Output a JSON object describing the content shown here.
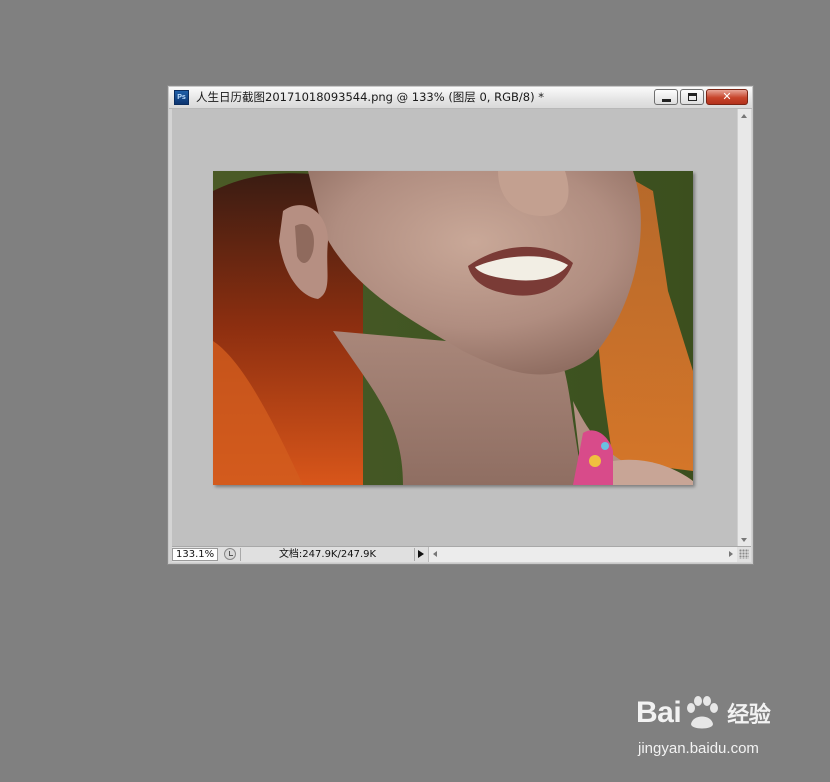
{
  "window": {
    "title": "人生日历截图20171018093544.png @ 133% (图层 0, RGB/8) *",
    "app_icon": "Ps",
    "buttons": {
      "minimize": "minimize-icon",
      "maximize": "maximize-icon",
      "close": "close-icon"
    }
  },
  "canvas": {
    "image_subject": "smiling-woman-photo"
  },
  "status_bar": {
    "zoom": "133.1%",
    "doc_info": "文档:247.9K/247.9K"
  },
  "watermark": {
    "brand_left": "Bai",
    "brand_right": "经验",
    "url": "jingyan.baidu.com"
  },
  "colors": {
    "workspace": "#808080",
    "canvas_bg": "#c0c0c0",
    "close_button": "#c7442b"
  }
}
